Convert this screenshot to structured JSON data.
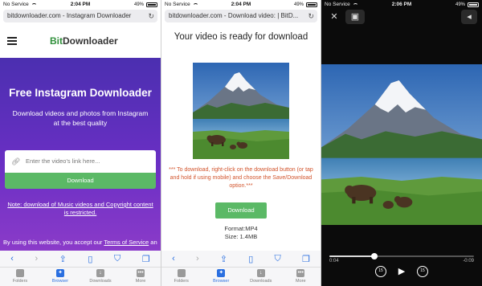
{
  "status": {
    "carrier": "No Service",
    "battery_pct": "49%",
    "times": [
      "2:04 PM",
      "2:04 PM",
      "2:06 PM"
    ]
  },
  "panel1": {
    "url": "bitdownloader.com - Instagram Downloader",
    "logo_bit": "Bit",
    "logo_rest": "Downloader",
    "title": "Free Instagram Downloader",
    "subtitle": "Download videos and photos from Instagram at the best quality",
    "input_placeholder": "Enter the video's link here...",
    "download_label": "Download",
    "note": "Note: download of Music videos and Copyright content is restricted.",
    "terms_prefix": "By using this website, you accept our ",
    "terms_link": "Terms of Service",
    "terms_suffix": " and"
  },
  "panel2": {
    "url": "bitdownloader.com - Download video: | BitD...",
    "heading": "Your video is ready for download",
    "instructions": "*** To download, right-click on the download button (or tap and hold if using mobile) and choose the Save/Download option.***",
    "download_label": "Download",
    "format": "Format:MP4",
    "size": "Size: 1.4MB"
  },
  "panel3": {
    "elapsed": "0:04",
    "remaining": "-0:09",
    "progress": 0.31,
    "skip_seconds": "15"
  },
  "tabbar": {
    "folders": "Folders",
    "browser": "Browser",
    "downloads": "Downloads",
    "more": "More"
  },
  "colors": {
    "hero_top": "#4b2fb0",
    "hero_bottom": "#8b3bc9",
    "download_green": "#5bb966",
    "instruction_orange": "#d2542c",
    "brand_green": "#2f8f3a",
    "ios_blue": "#2a6fe0"
  },
  "icons": [
    "menu-icon",
    "reload-icon",
    "link-icon",
    "back-icon",
    "forward-icon",
    "share-icon",
    "bookmarks-icon",
    "shield-icon",
    "tabs-icon",
    "folder-icon",
    "compass-icon",
    "download-icon",
    "more-icon",
    "close-icon",
    "pip-icon",
    "volume-icon",
    "rewind-15-icon",
    "play-icon",
    "forward-15-icon"
  ]
}
